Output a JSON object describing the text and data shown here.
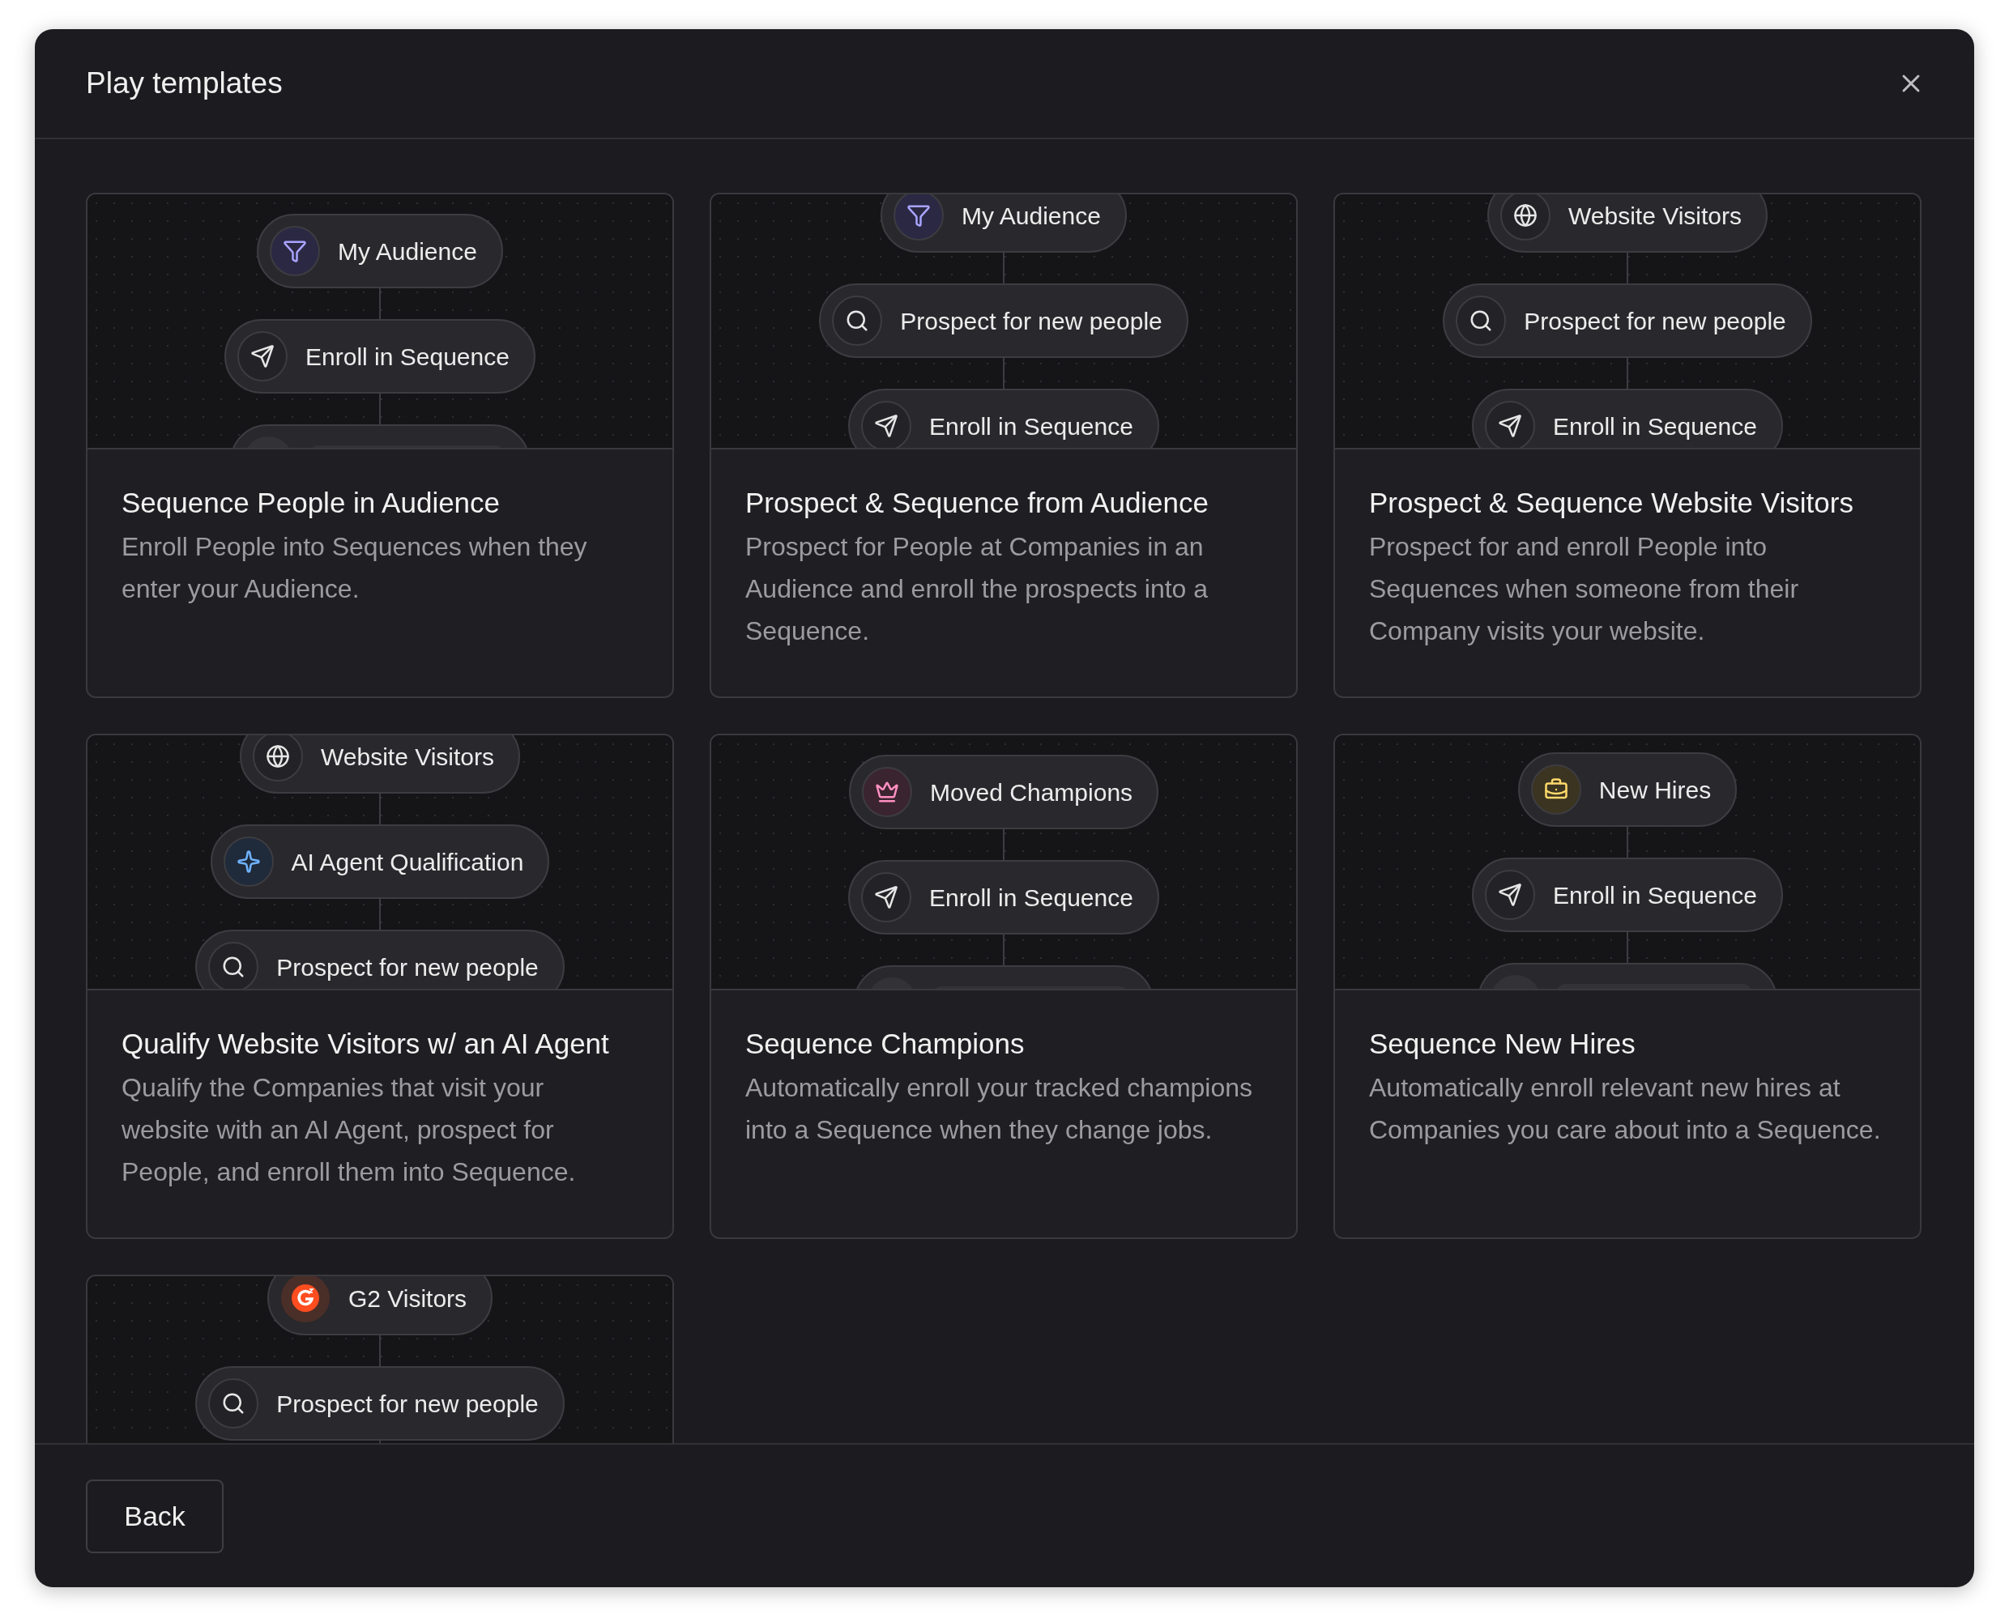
{
  "dialog": {
    "title": "Play templates"
  },
  "templates": [
    {
      "title": "Sequence People in Audience",
      "description": "Enroll People into Sequences when they enter your Audience.",
      "nodes": [
        {
          "kind": "filter",
          "label": "My Audience"
        },
        {
          "kind": "send",
          "label": "Enroll in Sequence"
        },
        {
          "kind": "placeholder"
        }
      ]
    },
    {
      "title": "Prospect & Sequence from Audience",
      "description": "Prospect for People at Companies in an Audience and enroll the prospects into a Sequence.",
      "nodes": [
        {
          "kind": "filter",
          "label": "My Audience"
        },
        {
          "kind": "search",
          "label": "Prospect for new people"
        },
        {
          "kind": "send",
          "label": "Enroll in Sequence"
        }
      ]
    },
    {
      "title": "Prospect & Sequence Website Visitors",
      "description": "Prospect for and enroll People into Sequences when someone from their Company visits your website.",
      "nodes": [
        {
          "kind": "globe",
          "label": "Website Visitors"
        },
        {
          "kind": "search",
          "label": "Prospect for new people"
        },
        {
          "kind": "send",
          "label": "Enroll in Sequence"
        }
      ]
    },
    {
      "title": "Qualify Website Visitors w/ an AI Agent",
      "description": "Qualify the Companies that visit your website with an AI Agent, prospect for People, and enroll them into Sequence.",
      "nodes": [
        {
          "kind": "globe",
          "label": "Website Visitors"
        },
        {
          "kind": "sparkle",
          "label": "AI Agent Qualification"
        },
        {
          "kind": "search",
          "label": "Prospect for new people"
        }
      ]
    },
    {
      "title": "Sequence Champions",
      "description": "Automatically enroll your tracked champions into a Sequence when they change jobs.",
      "nodes": [
        {
          "kind": "crown",
          "label": "Moved Champions"
        },
        {
          "kind": "send",
          "label": "Enroll in Sequence"
        },
        {
          "kind": "placeholder"
        }
      ]
    },
    {
      "title": "Sequence New Hires",
      "description": "Automatically enroll relevant new hires at Companies you care about into a Sequence.",
      "nodes": [
        {
          "kind": "briefcase",
          "label": "New Hires"
        },
        {
          "kind": "send",
          "label": "Enroll in Sequence"
        },
        {
          "kind": "placeholder"
        }
      ]
    },
    {
      "nodes": [
        {
          "kind": "g2",
          "label": "G2 Visitors"
        },
        {
          "kind": "search",
          "label": "Prospect for new people"
        }
      ]
    }
  ],
  "footer": {
    "back_button": "Back"
  }
}
